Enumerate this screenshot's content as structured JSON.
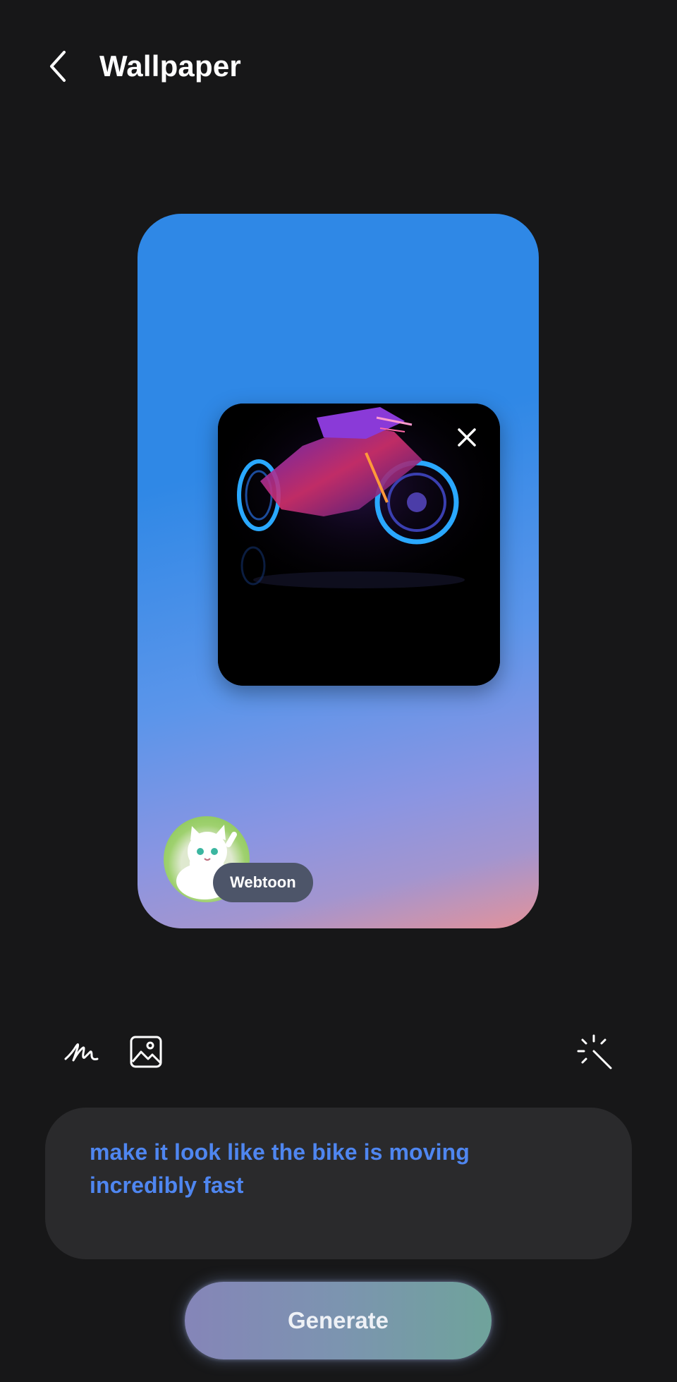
{
  "header": {
    "title": "Wallpaper",
    "back_icon": "chevron-left-icon"
  },
  "preview": {
    "image_subject": "neon motorcycle",
    "remove_icon": "close-icon",
    "style_chip_label": "Webtoon",
    "style_avatar_icon": "white-cat-avatar"
  },
  "tools": {
    "draw_icon": "handwriting-icon",
    "image_icon": "image-icon",
    "magic_icon": "sparkle-icon"
  },
  "prompt": {
    "text": "make it look like the bike is moving incredibly fast"
  },
  "actions": {
    "generate_label": "Generate"
  },
  "colors": {
    "background": "#171718",
    "prompt_text": "#4f86f0",
    "card_top": "#2f88e6",
    "card_bottom": "#e3929a"
  }
}
